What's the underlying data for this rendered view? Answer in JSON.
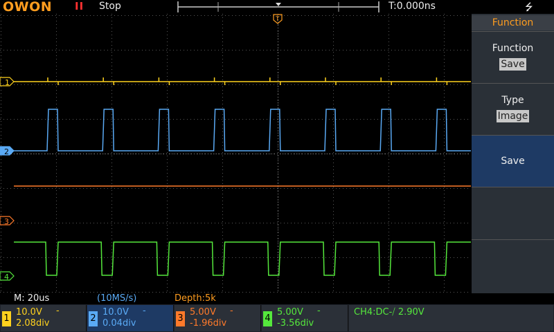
{
  "topbar": {
    "logo": "OWON",
    "run_icon": "II",
    "run_status": "Stop",
    "time_readout": "T:0.000ns",
    "usb_icon": "usb-icon"
  },
  "colors": {
    "ch1": "#ffd21e",
    "ch2": "#5aaaf5",
    "ch3": "#ff7a2a",
    "ch4": "#55e83c",
    "accent": "#ff9d1f",
    "menu_bg": "#2a3037",
    "menu_active": "#1e3a64"
  },
  "channel_markers": [
    "1",
    "2",
    "3",
    "4"
  ],
  "trigger_marker": "T",
  "menu": {
    "header": "Function",
    "items": [
      {
        "label": "Function",
        "value": "Save"
      },
      {
        "label": "Type",
        "value": "Image"
      },
      {
        "label": "Save",
        "value": ""
      },
      {
        "label": "",
        "value": ""
      },
      {
        "label": "",
        "value": ""
      }
    ]
  },
  "statusline": {
    "timebase": "M: 20us",
    "sample_rate": "(10MS/s)",
    "depth": "Depth:5k"
  },
  "channels": [
    {
      "num": "1",
      "volts": "10.0V",
      "offset": "2.08div",
      "coupling": "-"
    },
    {
      "num": "2",
      "volts": "10.0V",
      "offset": "0.04div",
      "coupling": "-"
    },
    {
      "num": "3",
      "volts": "5.00V",
      "offset": "-1.96div",
      "coupling": "-"
    },
    {
      "num": "4",
      "volts": "5.00V",
      "offset": "-3.56div",
      "coupling": "-"
    }
  ],
  "trigger_info": "CH4:DC-⧸ 2.90V"
}
